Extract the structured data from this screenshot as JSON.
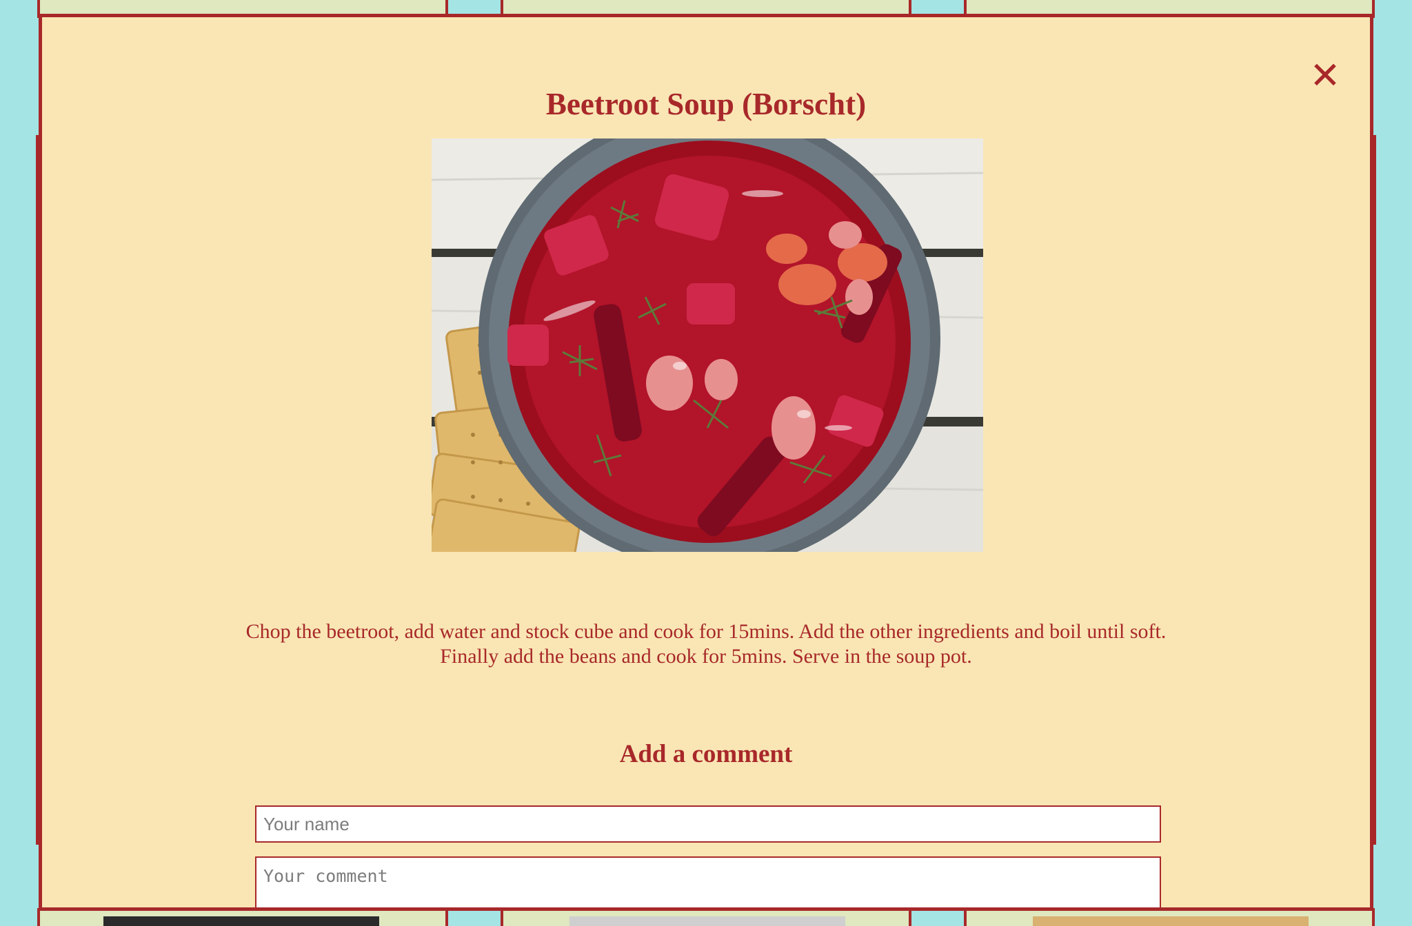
{
  "modal": {
    "title": "Beetroot Soup (Borscht)",
    "close_icon": "close-icon",
    "close_glyph": "✕",
    "image_subject": "recipe-photo",
    "instructions": "Chop the beetroot, add water and stock cube and cook for 15mins. Add the other ingredients and boil until soft. Finally add the beans and cook for 5mins. Serve in the soup pot.",
    "comment_heading": "Add a comment",
    "name_field": {
      "placeholder": "Your name",
      "value": ""
    },
    "comment_field": {
      "placeholder": "Your comment",
      "value": ""
    }
  },
  "colors": {
    "accent": "#a8282a",
    "modal_background": "#f9e6b4",
    "page_background": "#a4e4e4",
    "card_background": "#dfe8bf"
  }
}
